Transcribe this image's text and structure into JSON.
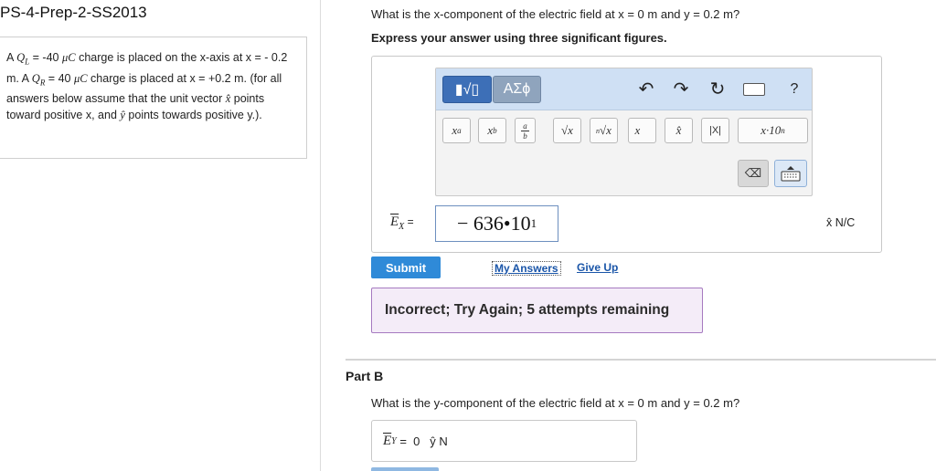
{
  "doc_title": "PS-4-Prep-2-SS2013",
  "problem": {
    "t1": "A ",
    "ql": "Q",
    "ql_sub": "L",
    "t2": " = -40 ",
    "unit1": "μC",
    "t3": " charge is placed on the x-axis at x = - 0.2 m. A ",
    "qr": "Q",
    "qr_sub": "R",
    "t4": " = 40 ",
    "unit2": "μC",
    "t5": " charge is placed at x = +0.2 m. (for all answers below assume that the unit vector ",
    "xhat": "x̂",
    "t6": " points toward positive x, and ",
    "yhat": "ŷ",
    "t7": " points towards positive y.)."
  },
  "partA": {
    "question": "What is the x-component of the electric field at x = 0 m and y = 0.2 m?",
    "instructions": "Express your answer using three significant figures.",
    "toolbar": {
      "templates_label": "▮√▯",
      "greek_label": "ΑΣϕ",
      "undo_icon": "↶",
      "redo_icon": "↷",
      "reset_icon": "↻",
      "help_label": "?",
      "sup_base": "x",
      "sup_exp": "a",
      "sub_base": "x",
      "sub_sub": "b",
      "frac_num": "a",
      "frac_den": "b",
      "sqrt_label": "√x",
      "nroot_index": "n",
      "nroot_label": "√x",
      "vec_label": "x⃗",
      "unitvec_label": "x̂",
      "abs_label": "|X|",
      "sci_base": "x·10",
      "sci_exp": "n",
      "backspace_label": "⌫"
    },
    "answer_label_base": "E",
    "answer_label_sub": "X",
    "answer_label_eq": " =",
    "answer_mantissa": "− 636",
    "answer_times": " • ",
    "answer_base": "10",
    "answer_exp": "1",
    "unit": "x̂ N/C",
    "submit_label": "Submit",
    "my_answers_label": "My Answers",
    "give_up_label": "Give Up",
    "feedback": "Incorrect; Try Again; 5 attempts remaining"
  },
  "partB": {
    "title": "Part B",
    "question": "What is the y-component of the electric field at x = 0 m and y = 0.2 m?",
    "answer_label_base": "E",
    "answer_label_sub": "Y",
    "answer_rest": " =  0   ŷ N"
  },
  "colors": {
    "submit": "#2f8ad8",
    "feedback_bg": "#f4ecf8",
    "feedback_border": "#a67ac0",
    "toolbar_top": "#cfe0f4",
    "link": "#1a55a8"
  }
}
